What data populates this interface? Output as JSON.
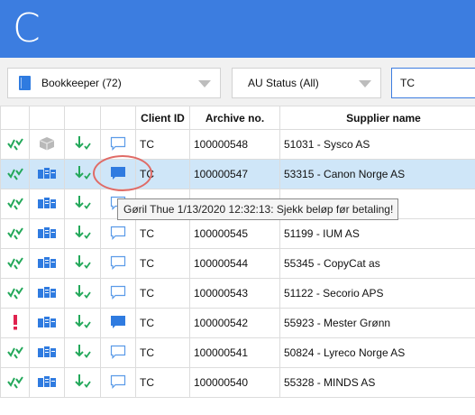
{
  "app": {
    "letter": "C"
  },
  "filters": {
    "bookkeeper": "Bookkeeper (72)",
    "au_status": "AU Status (All)",
    "search_value": "TC"
  },
  "table": {
    "columns": [
      "",
      "",
      "",
      "",
      "Client ID",
      "Archive no.",
      "Supplier name"
    ],
    "rows": [
      {
        "status": "ok",
        "type": "box",
        "comment": "empty",
        "client": "TC",
        "archive": "100000548",
        "supplier": "51031 - Sysco AS"
      },
      {
        "status": "ok",
        "type": "doc",
        "comment": "filled",
        "client": "TC",
        "archive": "100000547",
        "supplier": "53315 - Canon Norge AS",
        "selected": true
      },
      {
        "status": "ok",
        "type": "doc",
        "comment": "empty",
        "client": "",
        "archive": "",
        "supplier": ""
      },
      {
        "status": "ok",
        "type": "doc",
        "comment": "empty",
        "client": "TC",
        "archive": "100000545",
        "supplier": "51199 - IUM AS"
      },
      {
        "status": "ok",
        "type": "doc",
        "comment": "empty",
        "client": "TC",
        "archive": "100000544",
        "supplier": "55345 - CopyCat as"
      },
      {
        "status": "ok",
        "type": "doc",
        "comment": "empty",
        "client": "TC",
        "archive": "100000543",
        "supplier": "51122 - Secorio APS"
      },
      {
        "status": "alert",
        "type": "doc",
        "comment": "filled",
        "client": "TC",
        "archive": "100000542",
        "supplier": "55923 - Mester Grønn"
      },
      {
        "status": "ok",
        "type": "doc",
        "comment": "empty",
        "client": "TC",
        "archive": "100000541",
        "supplier": "50824 - Lyreco Norge AS"
      },
      {
        "status": "ok",
        "type": "doc",
        "comment": "empty",
        "client": "TC",
        "archive": "100000540",
        "supplier": "55328 - MINDS AS"
      }
    ]
  },
  "tooltip": {
    "text": "Gøril Thue 1/13/2020 12:32:13: Sjekk beløp før betaling!"
  },
  "colors": {
    "header": "#3c7de0",
    "green": "#23a85a",
    "blue": "#2f7be0",
    "alert": "#e0234f",
    "selected_row": "#cfe6f8",
    "highlight": "#e06b66"
  }
}
